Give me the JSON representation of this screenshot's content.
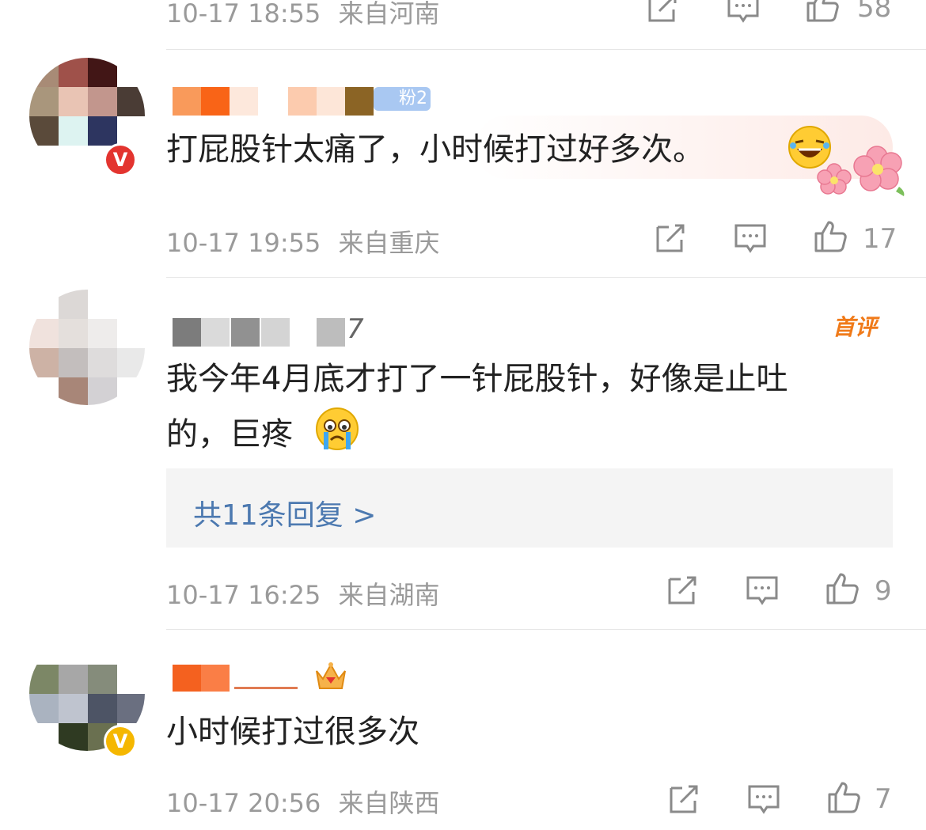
{
  "comments": [
    {
      "timestamp": "10-17 18:55",
      "location": "来自河南",
      "likes": "58"
    },
    {
      "username_badge": "粉2",
      "text": "打屁股针太痛了，小时候打过好多次。",
      "timestamp": "10-17 19:55",
      "location": "来自重庆",
      "likes": "17"
    },
    {
      "username_tail": "7",
      "tag": "首评",
      "text_line1": "我今年4月底才打了一针屁股针，好像是止吐",
      "text_line2": "的，巨疼",
      "replies_label": "共11条回复 >",
      "timestamp": "10-17 16:25",
      "location": "来自湖南",
      "likes": "9"
    },
    {
      "text": "小时候打过很多次",
      "timestamp": "10-17 20:56",
      "location": "来自陕西",
      "likes": "7"
    }
  ],
  "colors": {
    "meta_gray": "#9a9a9a",
    "link_blue": "#4c79b0",
    "tag_orange": "#f07a19",
    "verified_red": "#e3342f",
    "verified_yellow": "#f5b700"
  },
  "icons": [
    "share-icon",
    "comment-icon",
    "like-icon",
    "verified-icon",
    "crown-icon",
    "laughing-emoji",
    "crying-emoji",
    "flower-sticker"
  ]
}
